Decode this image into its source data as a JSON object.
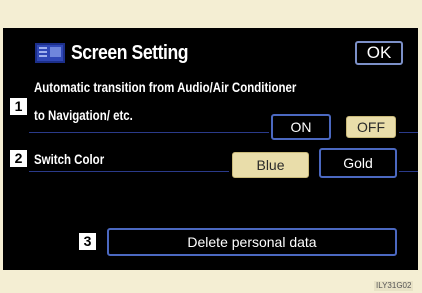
{
  "screen": {
    "title": "Screen Setting",
    "ok_label": "OK"
  },
  "settings": [
    {
      "number": "1",
      "label_line1": "Automatic transition from Audio/Air Conditioner",
      "label_line2": "to Navigation/ etc.",
      "options": [
        "ON",
        "OFF"
      ],
      "selected": "OFF"
    },
    {
      "number": "2",
      "label": "Switch Color",
      "options": [
        "Blue",
        "Gold"
      ],
      "selected": "Blue"
    },
    {
      "number": "3",
      "button_label": "Delete personal data"
    }
  ],
  "footer": {
    "code": "ILY31G02"
  },
  "colors": {
    "screen_bg": "#000000",
    "button_border": "#4b68c0",
    "selected_fill": "#e9ddaa",
    "page_bg": "#f4eed3"
  },
  "icons": {
    "title": "screen-settings-icon"
  }
}
